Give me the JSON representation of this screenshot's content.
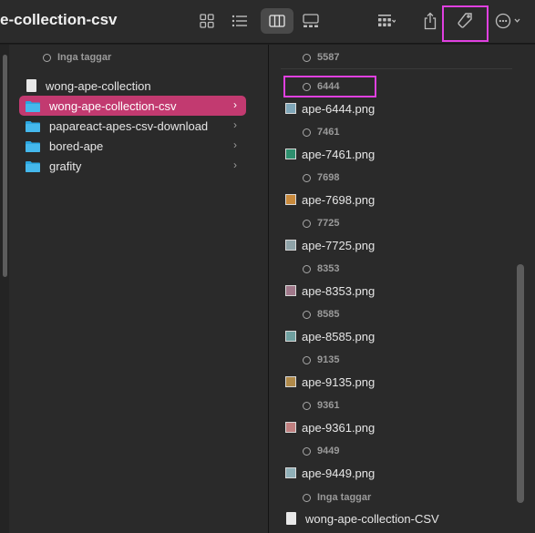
{
  "window": {
    "title": "e-collection-csv"
  },
  "toolbar": {
    "icons": [
      "icon-view-icon",
      "list-view-icon",
      "column-view-icon",
      "gallery-view-icon",
      "group-icon",
      "share-icon",
      "tag-icon",
      "more-icon"
    ],
    "chevron": "⌄"
  },
  "sidebar": {
    "tag_header": "Inga taggar",
    "items": [
      {
        "label": "wong-ape-collection",
        "kind": "document"
      },
      {
        "label": "wong-ape-collection-csv",
        "kind": "folder",
        "selected": true
      },
      {
        "label": "papareact-apes-csv-download",
        "kind": "folder"
      },
      {
        "label": "bored-ape",
        "kind": "folder"
      },
      {
        "label": "grafity",
        "kind": "folder"
      }
    ],
    "chevron": "›"
  },
  "files": {
    "top_tag": "5587",
    "groups": [
      {
        "tag": "6444",
        "file": "ape-6444.png",
        "thumb": "#7fa6b8"
      },
      {
        "tag": "7461",
        "file": "ape-7461.png",
        "thumb": "#2e8f6e"
      },
      {
        "tag": "7698",
        "file": "ape-7698.png",
        "thumb": "#c98a3c"
      },
      {
        "tag": "7725",
        "file": "ape-7725.png",
        "thumb": "#8ea3a8"
      },
      {
        "tag": "8353",
        "file": "ape-8353.png",
        "thumb": "#a0788a"
      },
      {
        "tag": "8585",
        "file": "ape-8585.png",
        "thumb": "#6fa0a0"
      },
      {
        "tag": "9135",
        "file": "ape-9135.png",
        "thumb": "#b08a4a"
      },
      {
        "tag": "9361",
        "file": "ape-9361.png",
        "thumb": "#c08080"
      },
      {
        "tag": "9449",
        "file": "ape-9449.png",
        "thumb": "#90b0b8"
      }
    ],
    "bottom_tag": "Inga taggar",
    "bottom_file": "wong-ape-collection-CSV"
  },
  "colors": {
    "accent": "#c23a70",
    "folder": "#2aa6e0",
    "highlight": "#e040e0"
  }
}
